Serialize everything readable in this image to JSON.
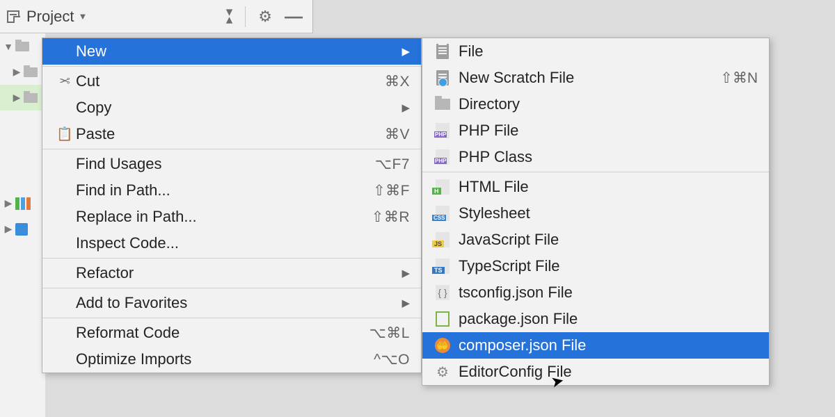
{
  "toolbar": {
    "projectLabel": "Project"
  },
  "contextMenu": [
    {
      "label": "New",
      "shortcut": "",
      "arrow": true,
      "icon": "",
      "selected": true
    },
    {
      "sep": true
    },
    {
      "label": "Cut",
      "shortcut": "⌘X",
      "icon": "scissors"
    },
    {
      "label": "Copy",
      "shortcut": "",
      "icon": "",
      "arrow": true
    },
    {
      "label": "Paste",
      "shortcut": "⌘V",
      "icon": "clipboard"
    },
    {
      "sep": true
    },
    {
      "label": "Find Usages",
      "shortcut": "⌥F7"
    },
    {
      "label": "Find in Path...",
      "shortcut": "⇧⌘F"
    },
    {
      "label": "Replace in Path...",
      "shortcut": "⇧⌘R"
    },
    {
      "label": "Inspect Code...",
      "shortcut": ""
    },
    {
      "sep": true
    },
    {
      "label": "Refactor",
      "shortcut": "",
      "arrow": true
    },
    {
      "sep": true
    },
    {
      "label": "Add to Favorites",
      "shortcut": "",
      "arrow": true
    },
    {
      "sep": true
    },
    {
      "label": "Reformat Code",
      "shortcut": "⌥⌘L"
    },
    {
      "label": "Optimize Imports",
      "shortcut": "^⌥O"
    }
  ],
  "newMenu": [
    {
      "label": "File",
      "icon": "file"
    },
    {
      "label": "New Scratch File",
      "icon": "scratch",
      "shortcut": "⇧⌘N"
    },
    {
      "label": "Directory",
      "icon": "dir"
    },
    {
      "label": "PHP File",
      "icon": "php"
    },
    {
      "label": "PHP Class",
      "icon": "php"
    },
    {
      "sep": true
    },
    {
      "label": "HTML File",
      "icon": "html"
    },
    {
      "label": "Stylesheet",
      "icon": "css"
    },
    {
      "label": "JavaScript File",
      "icon": "js"
    },
    {
      "label": "TypeScript File",
      "icon": "ts"
    },
    {
      "label": "tsconfig.json File",
      "icon": "tsconf"
    },
    {
      "label": "package.json File",
      "icon": "node"
    },
    {
      "label": "composer.json File",
      "icon": "composer",
      "selected": true
    },
    {
      "label": "EditorConfig File",
      "icon": "editorconf"
    }
  ]
}
